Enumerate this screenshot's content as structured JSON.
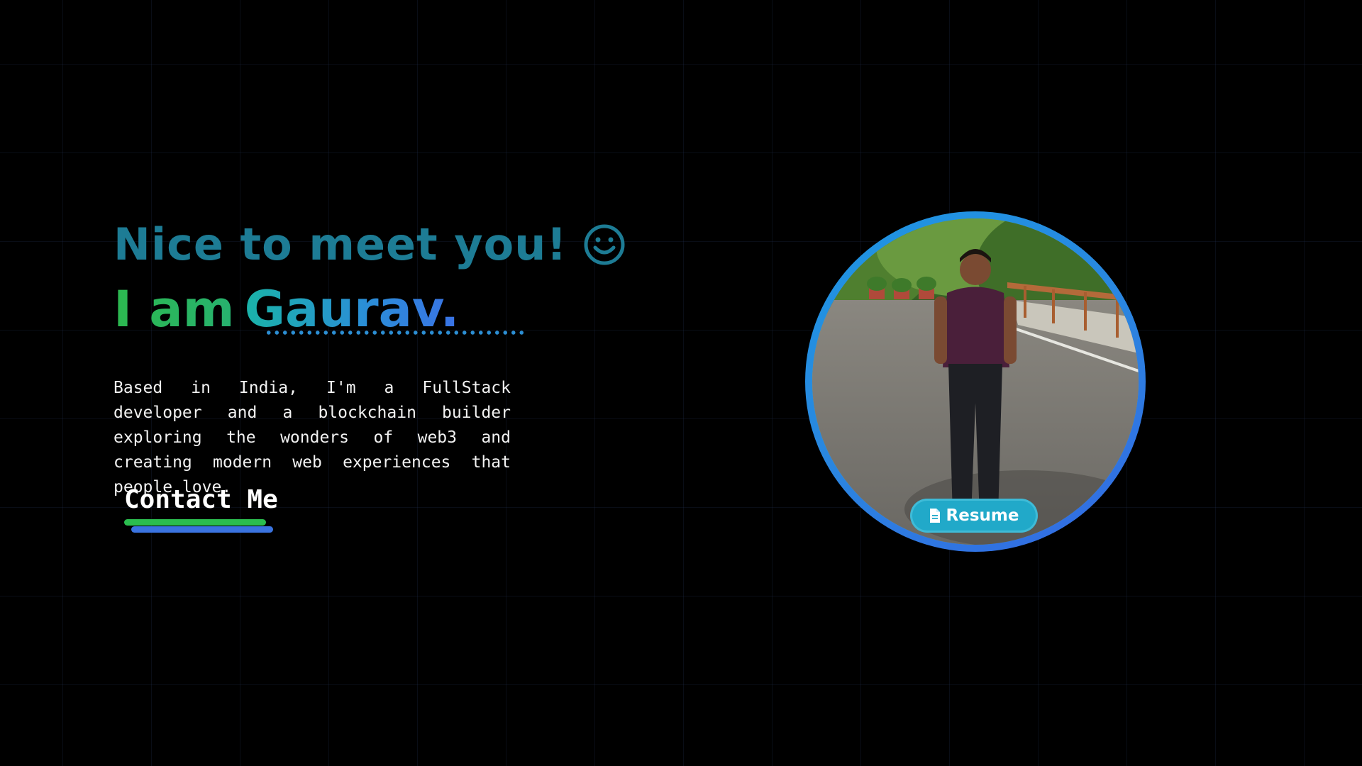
{
  "hero": {
    "greeting": "Nice to meet you!",
    "greeting_icon": "smiley-face-icon",
    "intro_prefix": "I am",
    "intro_name": "Gaurav.",
    "bio": "Based in India, I'm a FullStack developer and a blockchain builder exploring the wonders of web3 and creating modern web experiences that people love.",
    "contact_label": "Contact Me"
  },
  "profile": {
    "photo_alt": "Profile photo",
    "resume_label": "Resume",
    "resume_icon": "document-icon"
  },
  "colors": {
    "background": "#000000",
    "grid_line": "#1c2a44",
    "greeting": "#1d7c95",
    "intro_green": "#2cb84f",
    "name_blue": "#2a8fd6",
    "ring_blue": "#1d97e2",
    "resume_button": "#21a9c9",
    "contact_green_bar": "#2bbd4f",
    "contact_blue_bar": "#3a73e0"
  }
}
